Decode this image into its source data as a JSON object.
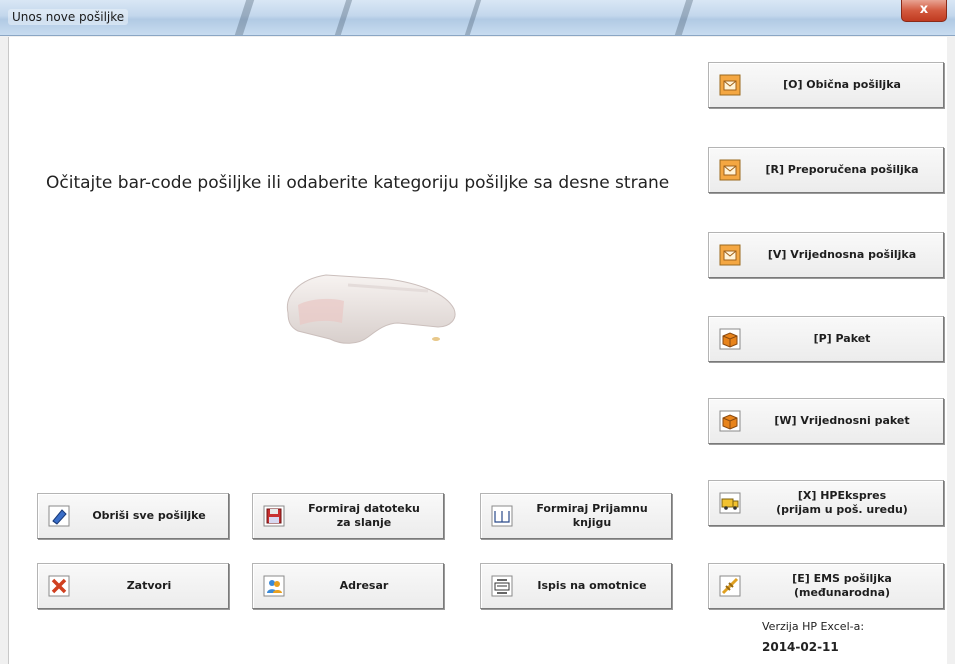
{
  "window": {
    "title": "Unos nove pošiljke",
    "close_label": "x"
  },
  "main": {
    "instruction": "Očitajte bar-code pošiljke ili odaberite kategoriju pošiljke sa desne strane"
  },
  "categories": {
    "obicna": "[O] Obična pošiljka",
    "preporucena": "[R] Preporučena  pošiljka",
    "vrijednosna": "[V] Vrijednosna pošiljka",
    "paket": "[P] Paket",
    "vrijednosni_paket": "[W] Vrijednosni paket",
    "hpekspres_line1": "[X] HPEkspres",
    "hpekspres_line2": "(prijam u poš. uredu)",
    "ems_line1": "[E] EMS pošiljka",
    "ems_line2": "(međunarodna)"
  },
  "actions": {
    "obrisi": "Obriši sve pošiljke",
    "formiraj_datoteku_line1": "Formiraj datoteku",
    "formiraj_datoteku_line2": "za slanje",
    "formiraj_prijamnu_line1": "Formiraj Prijamnu",
    "formiraj_prijamnu_line2": "knjigu",
    "zatvori": "Zatvori",
    "adresar": "Adresar",
    "ispis": "Ispis na omotnice"
  },
  "version": {
    "label": "Verzija HP Excel-a:",
    "date": "2014-02-11"
  },
  "icons": {
    "envelope": "envelope-icon",
    "package": "package-icon",
    "truck": "truck-icon",
    "airplane": "airplane-icon",
    "eraser": "eraser-icon",
    "save": "save-icon",
    "book": "book-icon",
    "close": "close-x-icon",
    "contacts": "contacts-icon",
    "print": "print-envelope-icon"
  },
  "colors": {
    "envelope_orange": "#e8902a",
    "package_orange": "#e07818",
    "close_red": "#d04020",
    "titlebar_blue": "#c3d7ec"
  }
}
